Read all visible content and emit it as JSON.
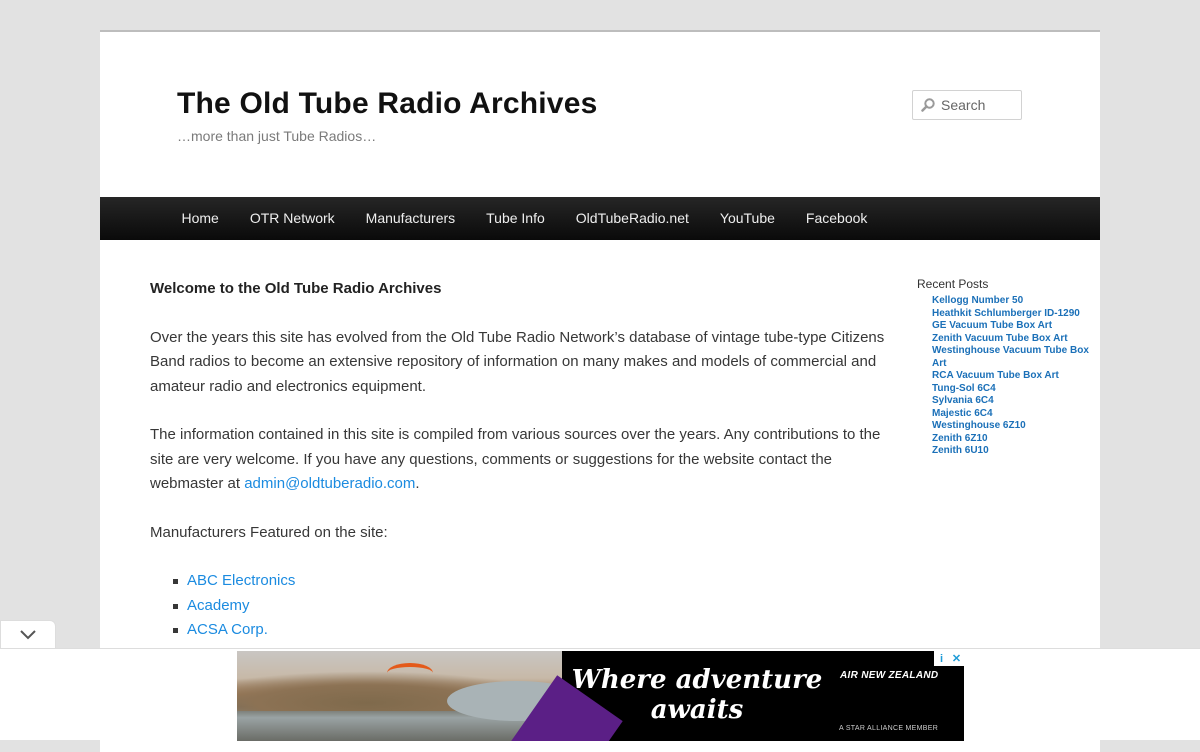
{
  "header": {
    "site_title": "The Old Tube Radio Archives",
    "site_description": "…more than just Tube Radios…",
    "search": {
      "placeholder": "Search",
      "icon": "search-icon"
    }
  },
  "nav": {
    "items": [
      "Home",
      "OTR Network",
      "Manufacturers",
      "Tube Info",
      "OldTubeRadio.net",
      "YouTube",
      "Facebook"
    ]
  },
  "main": {
    "welcome_heading": "Welcome to the Old Tube Radio Archives",
    "paragraph1": "Over the years  this site has evolved from the Old Tube Radio Network’s database of vintage tube-type Citizens Band radios to become an extensive repository of information on many makes and models of commercial and amateur radio and electronics equipment.",
    "paragraph2_text": "The information contained in this site is compiled from various sources over the years. Any contributions to the site are very welcome. If you have any questions, comments or suggestions for the website contact the webmaster at ",
    "paragraph2_email": "admin@oldtuberadio.com",
    "paragraph2_end": ".",
    "manufacturers_intro": "Manufacturers Featured on the site:",
    "manufacturers": [
      "ABC Electronics",
      "Academy",
      "ACSA Corp."
    ]
  },
  "sidebar": {
    "recent_posts_title": "Recent Posts",
    "recent_posts": [
      "Kellogg Number 50",
      "Heathkit Schlumberger ID-1290",
      "GE Vacuum Tube Box Art",
      "Zenith Vacuum Tube Box Art",
      "Westinghouse Vacuum Tube Box Art",
      "RCA Vacuum Tube Box Art",
      "Tung-Sol 6C4",
      "Sylvania 6C4",
      "Majestic 6C4",
      "Westinghouse 6Z10",
      "Zenith 6Z10",
      "Zenith 6U10"
    ]
  },
  "ad": {
    "headline": "Where adventure awaits",
    "brand": "AIR NEW ZEALAND",
    "alliance": "A STAR ALLIANCE MEMBER",
    "badges": [
      "i",
      "✕"
    ]
  },
  "colors": {
    "link": "#1b8be0",
    "sidebar_link": "#1b70b8",
    "nav_bg": "#1a1a1a",
    "page_bg": "#e2e2e2"
  }
}
